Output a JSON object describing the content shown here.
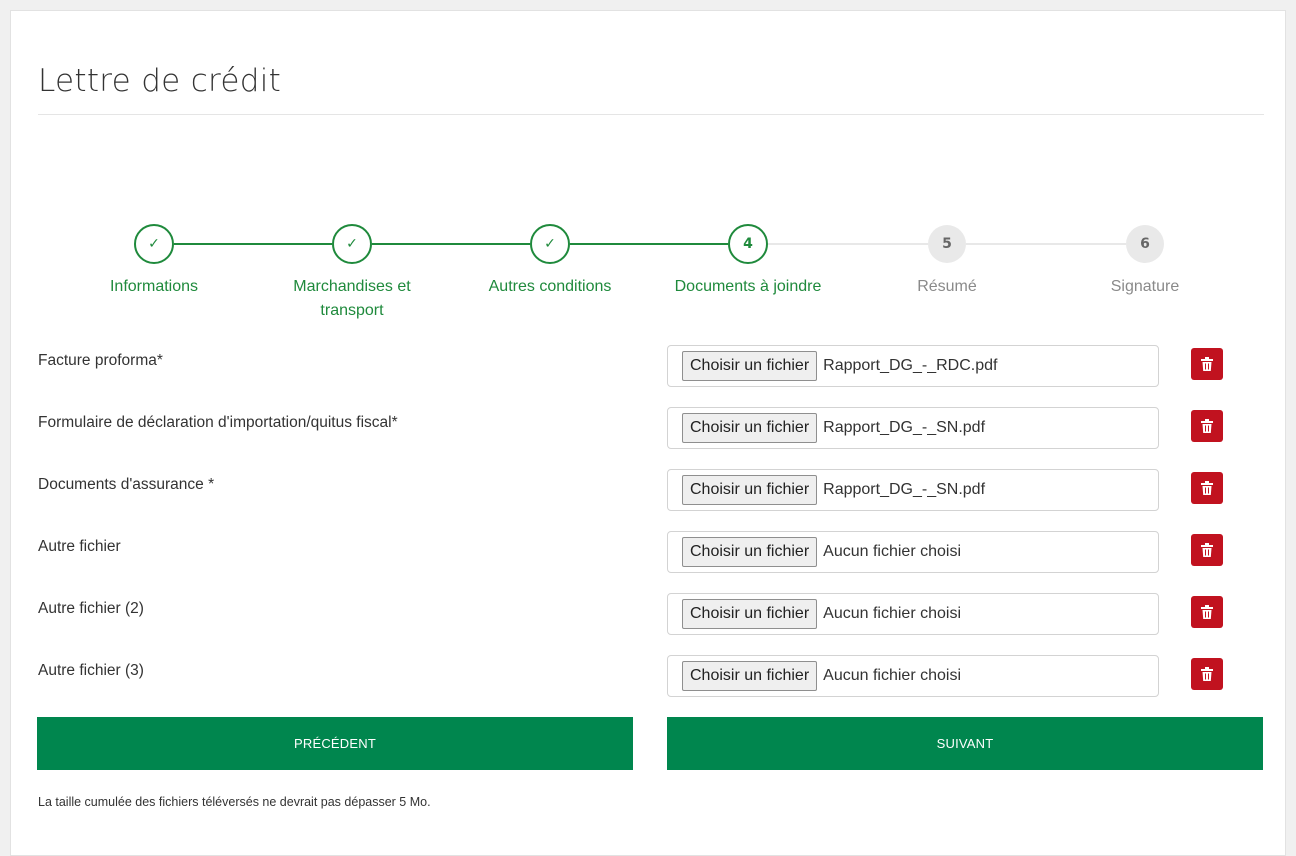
{
  "page": {
    "title": "Lettre de crédit"
  },
  "stepper": {
    "accent_color": "#1f8a3c",
    "steps": [
      {
        "label": "Informations",
        "marker": "✓",
        "state": "done"
      },
      {
        "label": "Marchandises et transport",
        "marker": "✓",
        "state": "done"
      },
      {
        "label": "Autres conditions",
        "marker": "✓",
        "state": "done"
      },
      {
        "label": "Documents à joindre",
        "marker": "4",
        "state": "active"
      },
      {
        "label": "Résumé",
        "marker": "5",
        "state": "todo"
      },
      {
        "label": "Signature",
        "marker": "6",
        "state": "todo"
      }
    ]
  },
  "documents": {
    "choose_file_label": "Choisir un fichier",
    "delete_icon": "trash-icon",
    "rows": [
      {
        "label": "Facture proforma*",
        "file": "Rapport_DG_-_RDC.pdf"
      },
      {
        "label": "Formulaire de déclaration d'importation/quitus fiscal*",
        "file": "Rapport_DG_-_SN.pdf"
      },
      {
        "label": "Documents d'assurance *",
        "file": "Rapport_DG_-_SN.pdf"
      },
      {
        "label": "Autre fichier",
        "file": "Aucun fichier choisi"
      },
      {
        "label": "Autre fichier (2)",
        "file": "Aucun fichier choisi"
      },
      {
        "label": "Autre fichier (3)",
        "file": "Aucun fichier choisi"
      }
    ]
  },
  "actions": {
    "previous_label": "PRÉCÉDENT",
    "next_label": "SUIVANT",
    "button_color": "#00864e"
  },
  "footnote": "La taille cumulée des fichiers téléversés ne devrait pas dépasser 5 Mo."
}
